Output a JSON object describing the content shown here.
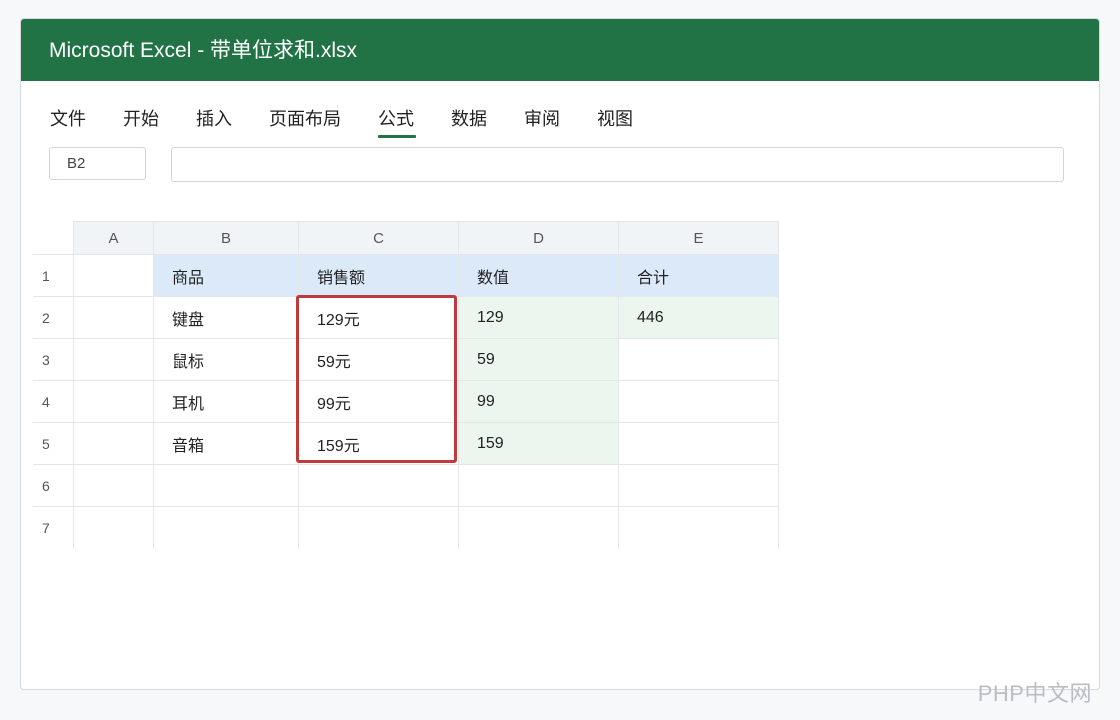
{
  "window": {
    "title": "Microsoft Excel - 带单位求和.xlsx"
  },
  "menu": {
    "items": [
      {
        "label": "文件",
        "active": false
      },
      {
        "label": "开始",
        "active": false
      },
      {
        "label": "插入",
        "active": false
      },
      {
        "label": "页面布局",
        "active": false
      },
      {
        "label": "公式",
        "active": true
      },
      {
        "label": "数据",
        "active": false
      },
      {
        "label": "审阅",
        "active": false
      },
      {
        "label": "视图",
        "active": false
      }
    ]
  },
  "formula_bar": {
    "name_box": "B2",
    "formula": ""
  },
  "sheet": {
    "columns": [
      "A",
      "B",
      "C",
      "D",
      "E"
    ],
    "rows": [
      {
        "num": "1",
        "cells": [
          "",
          "商品",
          "销售额",
          "数值",
          "合计"
        ]
      },
      {
        "num": "2",
        "cells": [
          "",
          "键盘",
          "129元",
          "129",
          "446"
        ]
      },
      {
        "num": "3",
        "cells": [
          "",
          "鼠标",
          "59元",
          "59",
          ""
        ]
      },
      {
        "num": "4",
        "cells": [
          "",
          "耳机",
          "99元",
          "99",
          ""
        ]
      },
      {
        "num": "5",
        "cells": [
          "",
          "音箱",
          "159元",
          "159",
          ""
        ]
      },
      {
        "num": "6",
        "cells": [
          "",
          "",
          "",
          "",
          ""
        ]
      },
      {
        "num": "7",
        "cells": [
          "",
          "",
          "",
          "",
          ""
        ]
      }
    ],
    "selected_range": "C2:C5"
  },
  "colors": {
    "title_bar": "#217346",
    "header_row_fill": "#dbe9f8",
    "value_column_fill": "#eaf6ee",
    "selection_border": "#c0393b"
  },
  "watermark": "PHP中文网"
}
